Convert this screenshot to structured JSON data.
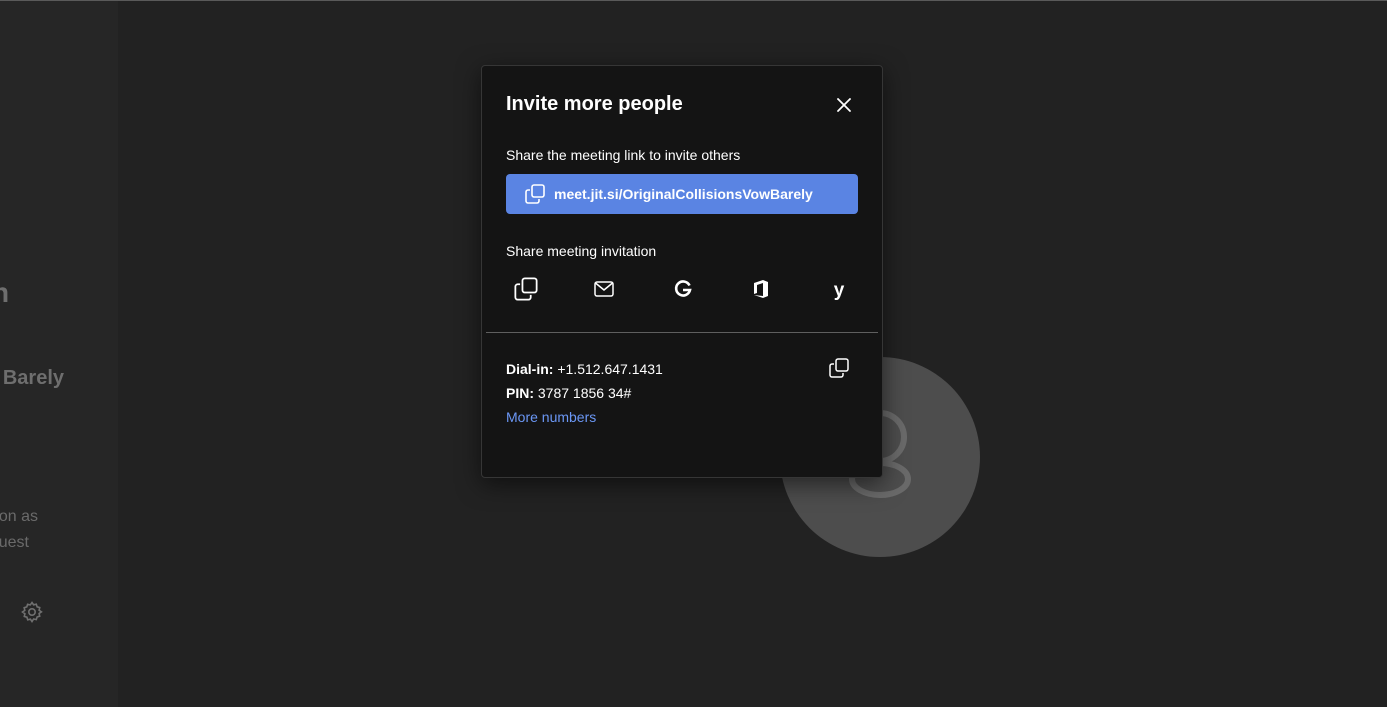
{
  "left_panel": {
    "heading_fragment": "n",
    "room_fragment": "Barely",
    "text_line1": "on as",
    "text_line2": "uest",
    "settings_icon": "gear-icon"
  },
  "dialog": {
    "title": "Invite more people",
    "close_icon": "close-icon",
    "link_section_label": "Share the meeting link to invite others",
    "meeting_link": "meet.jit.si/OriginalCollisionsVowBarely",
    "invitation_label": "Share meeting invitation",
    "share_options": [
      {
        "name": "copy-icon"
      },
      {
        "name": "email-icon"
      },
      {
        "name": "google-icon"
      },
      {
        "name": "office-icon"
      },
      {
        "name": "yahoo-icon"
      }
    ],
    "dial_in_label": "Dial-in:",
    "dial_in_number": "+1.512.647.1431",
    "pin_label": "PIN:",
    "pin_value": "3787 1856 34#",
    "more_numbers": "More numbers"
  },
  "colors": {
    "background": "#222222",
    "dialog_bg": "#141414",
    "accent_button": "#5a84e3",
    "link_color": "#6b97f5"
  }
}
